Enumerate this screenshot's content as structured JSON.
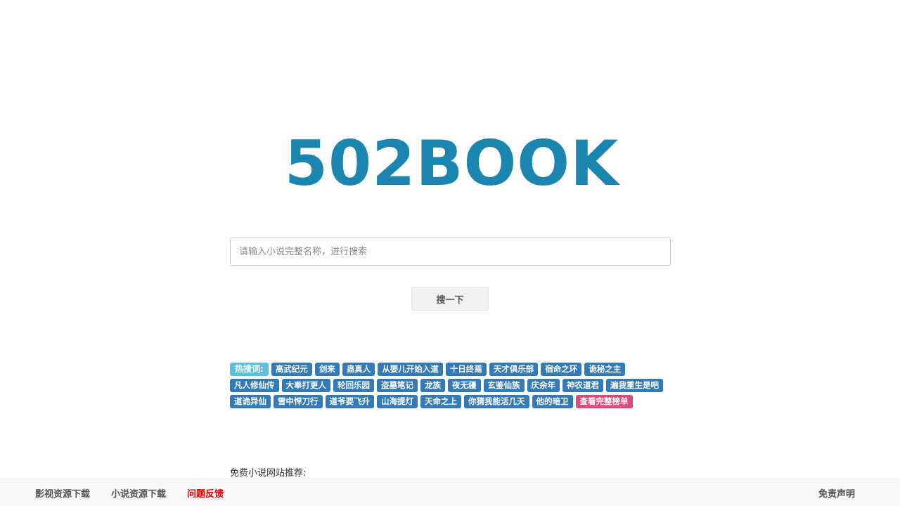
{
  "logo": {
    "text": "502BOOK",
    "color": "#1a86b0"
  },
  "search": {
    "placeholder": "请输入小说完整名称，进行搜索",
    "button_label": "搜一下"
  },
  "hot": {
    "label": "热搜词:",
    "tags": [
      "高武纪元",
      "剑来",
      "蛊真人",
      "从婴儿开始入道",
      "十日终焉",
      "天才俱乐部",
      "宿命之环",
      "诡秘之主",
      "凡人修仙传",
      "大奉打更人",
      "轮回乐园",
      "盗墓笔记",
      "龙族",
      "夜无疆",
      "玄鉴仙族",
      "庆余年",
      "神农道君",
      "遍我重生是吧",
      "道诡异仙",
      "雪中悍刀行",
      "道爷要飞升",
      "山海提灯",
      "天命之上",
      "你猜我能活几天",
      "他的暗卫"
    ],
    "full_list_label": "查看完整榜单"
  },
  "recommend": {
    "label": "免费小说网站推荐:"
  },
  "footer": {
    "links": [
      {
        "label": "影视资源下载"
      },
      {
        "label": "小说资源下载"
      },
      {
        "label": "问题反馈",
        "alert": true
      }
    ],
    "disclaimer": "免责声明"
  }
}
